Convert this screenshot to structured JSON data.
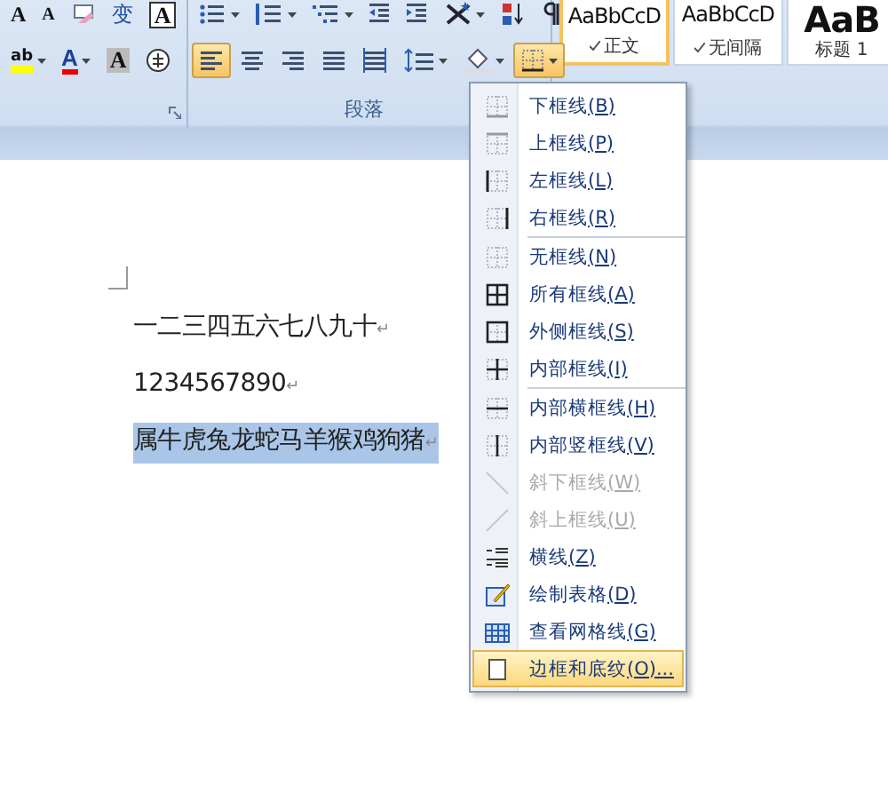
{
  "ribbon": {
    "font_group": {
      "rows": [
        [
          {
            "kind": "grow-font",
            "glyph": "A",
            "selected": false
          },
          {
            "kind": "shrink-font",
            "glyph": "A",
            "selected": false
          },
          {
            "kind": "clear-format",
            "selected": false
          },
          {
            "kind": "phonetic",
            "glyph": "变",
            "selected": false
          },
          {
            "kind": "char-border",
            "glyph": "A",
            "selected": false
          }
        ],
        [
          {
            "kind": "highlight",
            "glyph": "ab",
            "selected": false
          },
          {
            "kind": "font-color",
            "glyph": "A",
            "selected": false
          },
          {
            "kind": "char-shading",
            "glyph": "A",
            "selected": false
          },
          {
            "kind": "enclose",
            "selected": false
          }
        ]
      ]
    },
    "paragraph_group": {
      "label": "段落",
      "rows": [
        [
          {
            "kind": "bullets",
            "selected": false
          },
          {
            "kind": "numbering",
            "selected": false
          },
          {
            "kind": "multilevel",
            "selected": false
          },
          {
            "kind": "outdent",
            "selected": false
          },
          {
            "kind": "indent",
            "selected": false
          },
          {
            "kind": "asian-layout",
            "selected": false
          },
          {
            "kind": "sort",
            "selected": false
          },
          {
            "kind": "show-marks",
            "selected": false
          }
        ],
        [
          {
            "kind": "align-left",
            "selected": true
          },
          {
            "kind": "align-center",
            "selected": false
          },
          {
            "kind": "align-right",
            "selected": false
          },
          {
            "kind": "justify",
            "selected": false
          },
          {
            "kind": "distribute",
            "selected": false
          },
          {
            "kind": "line-spacing",
            "selected": false
          },
          {
            "kind": "shading",
            "selected": false
          },
          {
            "kind": "borders",
            "selected": true
          }
        ]
      ]
    },
    "styles": [
      {
        "sample": "AaBbCcD",
        "name": "正文",
        "selected": true,
        "kind": "normal"
      },
      {
        "sample": "AaBbCcD",
        "name": "无间隔",
        "selected": false,
        "kind": "normal"
      },
      {
        "sample": "AaB",
        "name": "标题 1",
        "selected": false,
        "kind": "heading"
      }
    ]
  },
  "document": {
    "paragraphs": [
      {
        "text": "一二三四五六七八九十",
        "mark": "↵",
        "selected": false
      },
      {
        "text": "1234567890",
        "mark": "↵",
        "selected": false
      },
      {
        "text": "属牛虎兔龙蛇马羊猴鸡狗猪",
        "mark": "↵",
        "selected": true
      }
    ]
  },
  "border_menu": {
    "items": [
      {
        "label": "下框线",
        "accel": "(B)",
        "disabled": false,
        "selected": false,
        "separator_before": false
      },
      {
        "label": "上框线",
        "accel": "(P)",
        "disabled": false,
        "selected": false,
        "separator_before": false
      },
      {
        "label": "左框线",
        "accel": "(L)",
        "disabled": false,
        "selected": false,
        "separator_before": false
      },
      {
        "label": "右框线",
        "accel": "(R)",
        "disabled": false,
        "selected": false,
        "separator_before": false
      },
      {
        "label": "无框线",
        "accel": "(N)",
        "disabled": false,
        "selected": false,
        "separator_before": true
      },
      {
        "label": "所有框线",
        "accel": "(A)",
        "disabled": false,
        "selected": false,
        "separator_before": false
      },
      {
        "label": "外侧框线",
        "accel": "(S)",
        "disabled": false,
        "selected": false,
        "separator_before": false
      },
      {
        "label": "内部框线",
        "accel": "(I)",
        "disabled": false,
        "selected": false,
        "separator_before": false
      },
      {
        "label": "内部横框线",
        "accel": "(H)",
        "disabled": false,
        "selected": false,
        "separator_before": true
      },
      {
        "label": "内部竖框线",
        "accel": "(V)",
        "disabled": false,
        "selected": false,
        "separator_before": false
      },
      {
        "label": "斜下框线",
        "accel": "(W)",
        "disabled": true,
        "selected": false,
        "separator_before": false
      },
      {
        "label": "斜上框线",
        "accel": "(U)",
        "disabled": true,
        "selected": false,
        "separator_before": false
      },
      {
        "label": "横线",
        "accel": "(Z)",
        "disabled": false,
        "selected": false,
        "separator_before": false
      },
      {
        "label": "绘制表格",
        "accel": "(D)",
        "disabled": false,
        "selected": false,
        "separator_before": false
      },
      {
        "label": "查看网格线",
        "accel": "(G)",
        "disabled": false,
        "selected": false,
        "separator_before": false
      },
      {
        "label": "边框和底纹",
        "accel": "(O)...",
        "disabled": false,
        "selected": true,
        "separator_before": false
      }
    ]
  }
}
